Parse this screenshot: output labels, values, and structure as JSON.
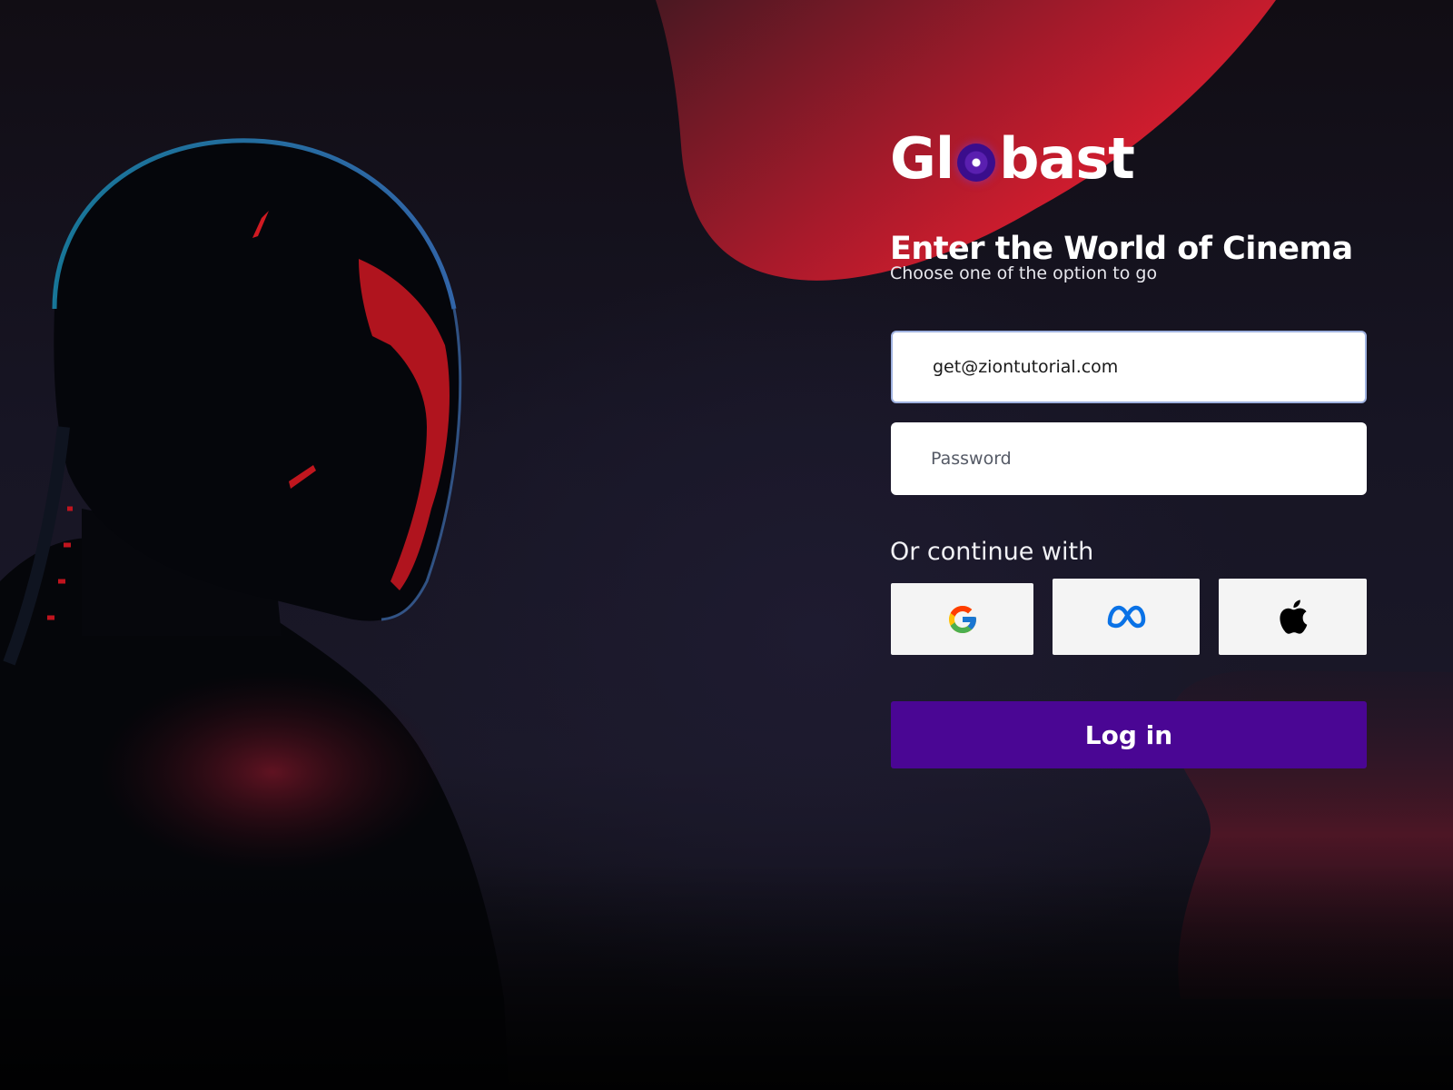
{
  "brand": {
    "name_left": "Gl",
    "name_right": "bast",
    "logo_icon": "purple-disc-icon"
  },
  "hero": {
    "title": "Enter the World of Cinema",
    "subtitle": "Choose one of the option to go"
  },
  "form": {
    "email_value": "get@ziontutorial.com",
    "password_placeholder": "Password",
    "continue_label": "Or continue with",
    "login_label": "Log in"
  },
  "social": [
    {
      "provider": "Google",
      "icon": "google-icon"
    },
    {
      "provider": "Meta",
      "icon": "meta-icon"
    },
    {
      "provider": "Apple",
      "icon": "apple-icon"
    }
  ],
  "colors": {
    "accent_red": "#d3182a",
    "login_purple": "#4a0694",
    "background_dark": "#171524",
    "input_bg": "#ffffff",
    "social_bg": "#f4f4f4"
  }
}
